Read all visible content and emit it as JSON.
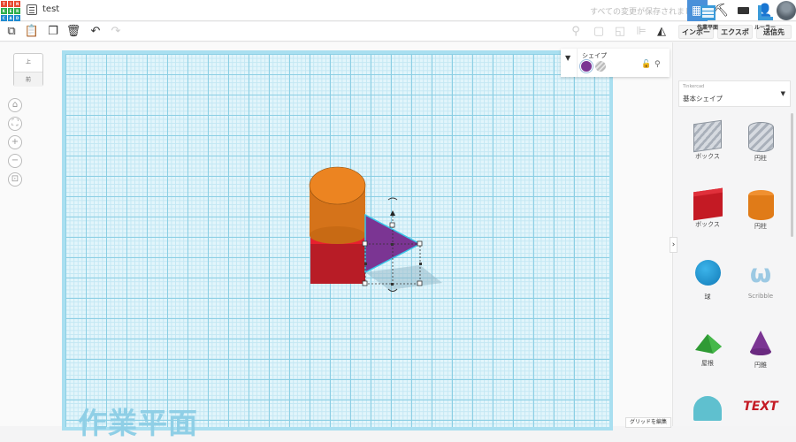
{
  "header": {
    "logo": [
      "T",
      "I",
      "N",
      "K",
      "E",
      "R",
      "C",
      "A",
      "D"
    ],
    "title": "test",
    "save_status": "すべての変更が保存されました"
  },
  "toolbar": {
    "import": "インポート",
    "export": "エクスポート",
    "send": "送信先"
  },
  "viewcube": {
    "top": "上",
    "front": "前"
  },
  "shape_panel": {
    "title": "シェイプ"
  },
  "right_panel": {
    "workplane": "作業平面",
    "ruler": "ルーラー",
    "library_category": "Tinkercad",
    "library_value": "基本シェイプ",
    "shapes": [
      {
        "label": "ボックス"
      },
      {
        "label": "円柱"
      },
      {
        "label": "ボックス"
      },
      {
        "label": "円柱"
      },
      {
        "label": "球"
      },
      {
        "label": "Scribble"
      },
      {
        "label": "屋根"
      },
      {
        "label": "円錐"
      }
    ]
  },
  "workplane_label": "作業平面",
  "edit_grid": "グリッドを編集",
  "colors": {
    "accent": "#4a90d9",
    "box_red": "#c0202a",
    "cylinder_orange": "#e8801f",
    "cone_purple": "#7b3593"
  }
}
